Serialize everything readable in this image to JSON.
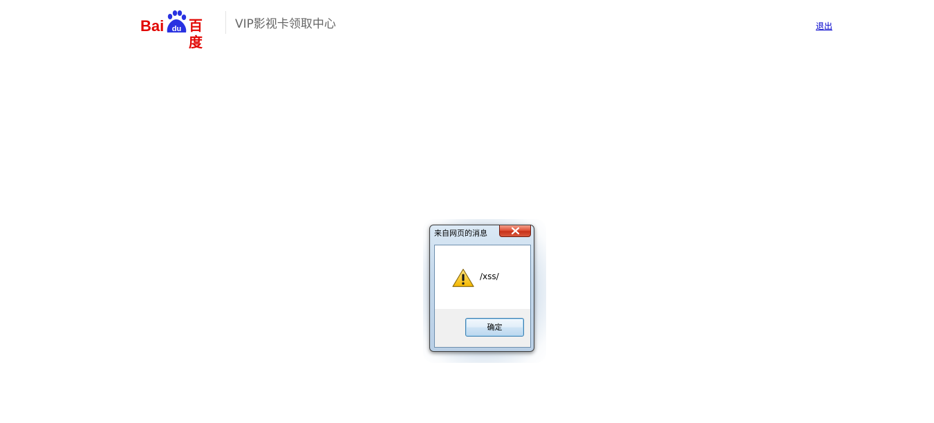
{
  "header": {
    "logo": {
      "brand_latin": "Bai",
      "brand_paw": "du",
      "brand_cn": "百度",
      "icon": "baidu-paw-logo"
    },
    "site_title": "VIP影视卡领取中心",
    "logout_link": "退出"
  },
  "dialog": {
    "title": "来自网页的消息",
    "message": "/xss/",
    "ok_button": "确定",
    "icons": {
      "warning": "warning-icon",
      "close": "close-icon"
    }
  },
  "colors": {
    "brand_red": "#e10602",
    "brand_blue": "#2932e1",
    "link": "#0000cc",
    "title_text": "#666666"
  }
}
